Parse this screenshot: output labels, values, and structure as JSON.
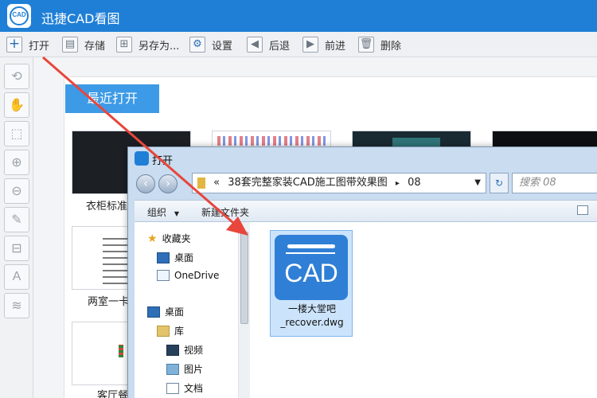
{
  "app": {
    "title": "迅捷CAD看图",
    "logo_text": "CAD"
  },
  "toolbar": {
    "open_label": "打开",
    "save_label": "存储",
    "save_as_label": "另存为...",
    "settings_label": "设置",
    "back_label": "后退",
    "forward_label": "前进",
    "delete_label": "删除"
  },
  "recent": {
    "tab_label": "最近打开",
    "items": [
      {
        "label": "衣柜标准"
      },
      {
        "label": "两室一卡"
      },
      {
        "label": "客厅餐"
      }
    ]
  },
  "dialog": {
    "title": "打开",
    "address_prefix": "«",
    "address_folder": "38套完整家装CAD施工图带效果图",
    "address_sep": "▸",
    "address_sub": "08",
    "search_placeholder": "搜索 08",
    "organize_label": "组织",
    "new_folder_label": "新建文件夹",
    "nav": {
      "favorites": "收藏夹",
      "desktop_fav": "桌面",
      "onedrive": "OneDrive",
      "desktop": "桌面",
      "library": "库",
      "videos": "视频",
      "pictures": "图片",
      "documents": "文档"
    },
    "file": {
      "icon_text": "CAD",
      "name_line1": "一楼大堂吧",
      "name_line2": "_recover.dwg"
    }
  },
  "colors": {
    "titlebar": "#1f7fd6",
    "accent_tab": "#3d9ae6",
    "arrow": "#e8463c",
    "cad_icon": "#2f7fd6"
  }
}
